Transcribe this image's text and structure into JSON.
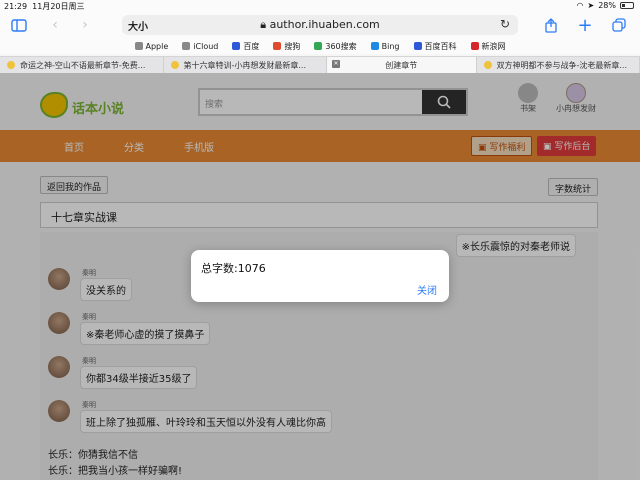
{
  "status_bar": {
    "time": "21:29",
    "date": "11月20日周三",
    "battery": "28%"
  },
  "toolbar": {
    "reader_label": "大小",
    "url": "author.ihuaben.com"
  },
  "bookmarks": [
    {
      "label": "Apple",
      "color": "#888888"
    },
    {
      "label": "iCloud",
      "color": "#888888"
    },
    {
      "label": "百度",
      "color": "#2d58d8"
    },
    {
      "label": "搜狗",
      "color": "#e04a2f"
    },
    {
      "label": "360搜索",
      "color": "#32a852"
    },
    {
      "label": "Bing",
      "color": "#1e88e5"
    },
    {
      "label": "百度百科",
      "color": "#2d58d8"
    },
    {
      "label": "新浪网",
      "color": "#d7262b"
    }
  ],
  "tabs": [
    {
      "label": "命运之神-空山不语最新章节-免费..."
    },
    {
      "label": "第十六章特训-小冉想发财最新章..."
    },
    {
      "label": "创建章节",
      "active": true
    },
    {
      "label": "双方神明都不参与战争-沈老最新章..."
    }
  ],
  "site": {
    "logo_text": "话本小说",
    "search_placeholder": "搜索",
    "bookshelf_label": "书架",
    "user_label": "小冉想发财",
    "nav": [
      "首页",
      "分类",
      "手机版"
    ],
    "write_welfare": "写作福利",
    "write_backend": "写作后台",
    "back_button": "返回我的作品",
    "word_count_button": "字数统计",
    "chapter_title": "十七章实战课"
  },
  "chat": {
    "right_bubble": "※长乐震惊的对秦老师说",
    "messages": [
      {
        "name": "秦明",
        "text": "没关系的"
      },
      {
        "name": "秦明",
        "text": "※秦老师心虚的摸了摸鼻子"
      },
      {
        "name": "秦明",
        "text": "你都34级半接近35级了"
      },
      {
        "name": "秦明",
        "text": "班上除了独孤雁、叶玲玲和玉天恒以外没有人魂比你高"
      }
    ],
    "plain_lines": [
      "长乐：你猜我信不信",
      "长乐：把我当小孩一样好骗啊!"
    ]
  },
  "dialog": {
    "message": "总字数:1076",
    "close_label": "关闭"
  },
  "colors": {
    "accent": "#2d7cf6",
    "nav_orange": "#e98a34",
    "backend_red": "#e23b3b"
  }
}
